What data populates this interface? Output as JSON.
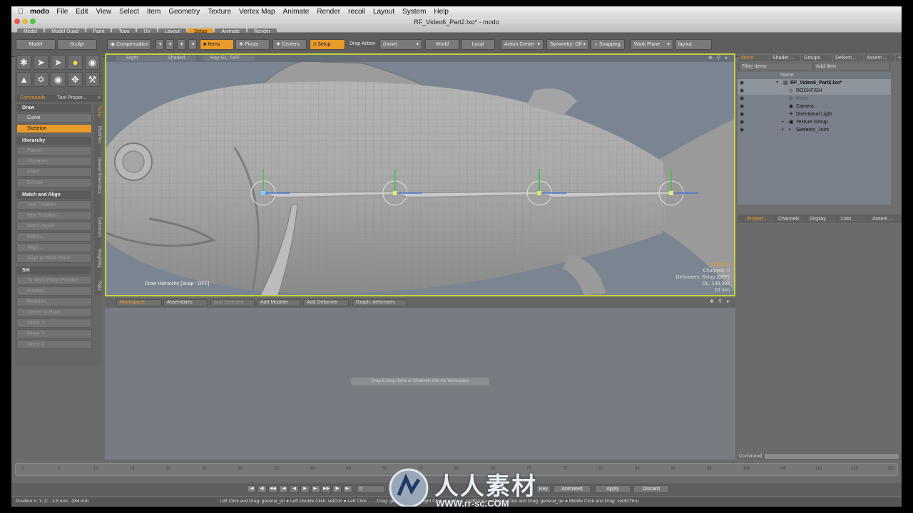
{
  "menubar": {
    "app": "modo",
    "items": [
      "File",
      "Edit",
      "View",
      "Select",
      "Item",
      "Geometry",
      "Texture",
      "Vertex Map",
      "Animate",
      "Render",
      "recoil",
      "Layout",
      "System",
      "Help"
    ]
  },
  "window": {
    "title": "RF_Video6_Part2.lxo* - modo"
  },
  "layout_tabs": [
    "Model",
    "Model Quad",
    "Paint",
    "Topo",
    "UV",
    "Layout",
    "Setup",
    "Animate",
    "Render"
  ],
  "layout_tabs_active": "Setup",
  "toolbar": {
    "model": "Model",
    "sculpt": "Sculpt",
    "compensation": "Compensation",
    "items": "Items",
    "pivots": "Pivots",
    "centers": "Centers",
    "setup": "Setup",
    "drop_action": "Drop Action",
    "none": "(none)",
    "world": "World",
    "local": "Local",
    "action_center": "Action Center",
    "symmetry": "Symmetry: Off",
    "snapping": "Snapping",
    "work_plane": "Work Plane",
    "layout": "layout"
  },
  "left_tabs": {
    "commands": "Commands",
    "tool_props": "Tool Proper..."
  },
  "left_vtabs": [
    "Setup",
    "Modifiers",
    "Inverse Kinematics",
    "Deformers",
    "Weighting",
    "Rigid"
  ],
  "left_sections": [
    {
      "header": "Draw",
      "items": [
        {
          "label": "Curve",
          "state": "enabled"
        },
        {
          "label": "Skeleton",
          "state": "active"
        }
      ]
    },
    {
      "header": "Hierarchy",
      "items": [
        {
          "label": "Parent",
          "state": "disabled"
        },
        {
          "label": "Unparent",
          "state": "disabled"
        },
        {
          "label": "Insert",
          "state": "disabled"
        },
        {
          "label": "Extract",
          "state": "disabled"
        }
      ]
    },
    {
      "header": "Match and Align",
      "items": [
        {
          "label": "Item Position",
          "state": "disabled"
        },
        {
          "label": "Item Rotation",
          "state": "disabled"
        },
        {
          "label": "Match Scale",
          "state": "disabled"
        },
        {
          "label": "Match...",
          "state": "disabled"
        },
        {
          "label": "Align...",
          "state": "disabled"
        },
        {
          "label": "Align to Work Plane",
          "state": "disabled"
        }
      ]
    },
    {
      "header": "Set",
      "items": [
        {
          "label": "To Work Plane Position",
          "state": "disabled"
        },
        {
          "label": "Position...",
          "state": "disabled"
        },
        {
          "label": "Rotation...",
          "state": "disabled"
        },
        {
          "label": "Center to Pivot",
          "state": "disabled"
        },
        {
          "label": "Mirror X",
          "state": "disabled"
        },
        {
          "label": "Mirror Y",
          "state": "disabled"
        },
        {
          "label": "Mirror Z",
          "state": "disabled"
        }
      ]
    }
  ],
  "viewport": {
    "view": "Right",
    "shading": "Shaded",
    "ray": "Ray GL: OFF",
    "status": "Draw Hierarchy [Snap : OFF]",
    "info": {
      "title": "No Items",
      "channels": "Channels: 0",
      "deformers": "Deformers: Setup (OFF)",
      "gl": "GL: 149,392",
      "size": "10 mm"
    },
    "joints": [
      0.25,
      0.46,
      0.69,
      0.9
    ]
  },
  "workspace": {
    "label": "Workspace",
    "assemblies": "Assemblies",
    "add_selected": "Add Selected",
    "add_modifier": "Add Modifier",
    "add_deformer": "Add Deformer",
    "graph": "Graph: deformers",
    "message": "Drag & Drop Items or Channels into the Workspace"
  },
  "right_tabs": [
    "Items",
    "Shader ...",
    "Groups",
    "Deform...",
    "Assem ..."
  ],
  "right_tabs_active": "Items",
  "items_panel": {
    "filter": "Filter Items",
    "add_item": "Add Item",
    "name_header": "Name",
    "rows": [
      {
        "name": "RF_Video6_Part2.lxo*",
        "indent": 0,
        "icon": "scene"
      },
      {
        "name": "ROCKFISH",
        "indent": 1,
        "icon": "mesh"
      },
      {
        "name": "Mesh",
        "indent": 1,
        "icon": "mesh"
      },
      {
        "name": "Camera",
        "indent": 1,
        "icon": "camera"
      },
      {
        "name": "Directional Light",
        "indent": 1,
        "icon": "light"
      },
      {
        "name": "Texture Group",
        "indent": 1,
        "icon": "group"
      },
      {
        "name": "Skeleton_Joint",
        "indent": 1,
        "icon": "joint"
      }
    ]
  },
  "props_tabs": [
    "Propert...",
    "Channels",
    "Display",
    "Lists",
    "Assem ..."
  ],
  "props_tabs_active": "Propert...",
  "command_label": "Command",
  "timeline_ticks": [
    0,
    5,
    10,
    15,
    20,
    25,
    30,
    35,
    40,
    45,
    50,
    55,
    60,
    65,
    70,
    75,
    80,
    85,
    90,
    95,
    100,
    105,
    110,
    115,
    120
  ],
  "playback": {
    "frame": "0",
    "animated": "Animated",
    "apply": "Apply",
    "discard": "Discard",
    "key": "Key"
  },
  "statusbar": {
    "left": "Position X, Y, Z:  , 3.5 mm, -284 mm",
    "hints": "Left Click and Drag: general_pri ● Left Double Click: selCon ● Left Click ...  ...Drag: general_sec ● Right Click and Drag: sel3DArea ● Middle Click and Drag: general_ter ● Middle Click and Drag: sel3DThru"
  },
  "watermark": {
    "cn": "人人素材",
    "url": "WWW.rr-sc.COM"
  }
}
